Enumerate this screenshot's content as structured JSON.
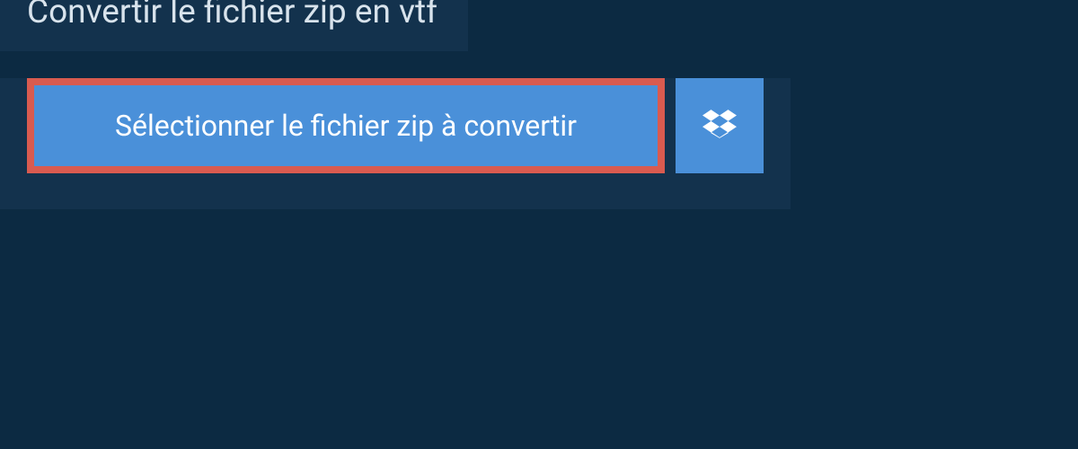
{
  "header": {
    "title": "Convertir le fichier zip en vtf"
  },
  "actions": {
    "select_file_label": "Sélectionner le fichier zip à convertir",
    "dropbox_icon": "dropbox"
  },
  "colors": {
    "background": "#0c2a42",
    "panel": "#13324d",
    "button": "#4a90d9",
    "highlight_border": "#d95b50",
    "text_light": "#d8e3ec",
    "text_white": "#ffffff"
  }
}
